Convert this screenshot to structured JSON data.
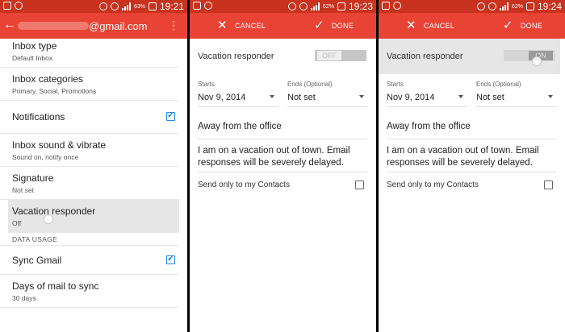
{
  "screen1": {
    "status": {
      "battery": "63%",
      "time": "19:21"
    },
    "account_domain": "@gmail.com",
    "items": [
      {
        "title": "Inbox type",
        "subtitle": "Default Inbox"
      },
      {
        "title": "Inbox categories",
        "subtitle": "Primary, Social, Promotions"
      },
      {
        "title": "Notifications",
        "checked": true
      },
      {
        "title": "Inbox sound & vibrate",
        "subtitle": "Sound on, notify once"
      },
      {
        "title": "Signature",
        "subtitle": "Not set"
      },
      {
        "title": "Vacation responder",
        "subtitle": "Off"
      }
    ],
    "section_header": "DATA USAGE",
    "sync": {
      "title": "Sync Gmail",
      "checked": true
    },
    "days": {
      "title": "Days of mail to sync",
      "subtitle": "30 days"
    }
  },
  "screen2": {
    "status": {
      "battery": "62%",
      "time": "19:23"
    },
    "toggle_text": "OFF",
    "toggle_on": false
  },
  "screen3": {
    "status": {
      "battery": "62%",
      "time": "19:24"
    },
    "toggle_text": "ON",
    "toggle_on": true
  },
  "editor": {
    "cancel_label": "CANCEL",
    "done_label": "DONE",
    "vacation_label": "Vacation responder",
    "starts_label": "Starts",
    "starts_value": "Nov 9, 2014",
    "ends_label": "Ends (Optional)",
    "ends_value": "Not set",
    "subject": "Away from the office",
    "message": "I am on a vacation out of town. Email responses will be severely delayed.",
    "contacts_label": "Send only to my Contacts",
    "contacts_checked": false
  },
  "colors": {
    "status_bar": "#c8321e",
    "app_bar": "#e84335",
    "checkbox_accent": "#1e88e5"
  }
}
